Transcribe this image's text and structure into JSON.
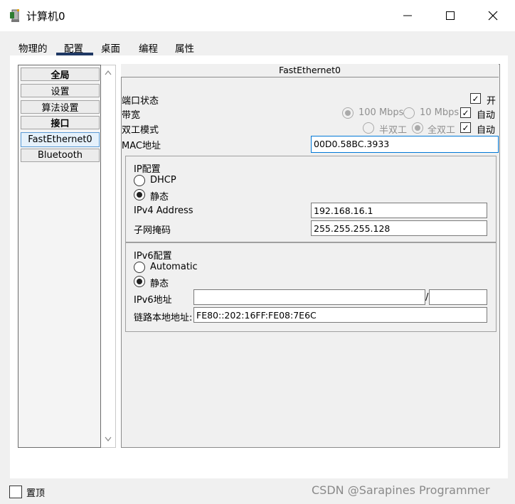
{
  "window": {
    "title": "计算机0",
    "app_icon": "computer-app-icon",
    "controls": [
      "minimize-icon",
      "maximize-icon",
      "close-icon"
    ]
  },
  "tabs": [
    {
      "label": "物理的"
    },
    {
      "label": "配置",
      "active": true
    },
    {
      "label": "桌面"
    },
    {
      "label": "编程"
    },
    {
      "label": "属性"
    }
  ],
  "sidebar": {
    "items": [
      {
        "label": "全局",
        "kind": "header"
      },
      {
        "label": "设置"
      },
      {
        "label": "算法设置"
      },
      {
        "label": "接口",
        "kind": "header"
      },
      {
        "label": "FastEthernet0",
        "selected": true
      },
      {
        "label": "Bluetooth"
      }
    ]
  },
  "interface": {
    "title": "FastEthernet0",
    "port_status": {
      "label": "端口状态",
      "checked": true,
      "option": "开"
    },
    "bandwidth": {
      "label": "带宽",
      "options": [
        "100 Mbps",
        "10 Mbps"
      ],
      "selected": "100 Mbps",
      "auto_label": "自动",
      "auto": true
    },
    "duplex": {
      "label": "双工模式",
      "options": [
        "半双工",
        "全双工"
      ],
      "selected": "全双工",
      "auto_label": "自动",
      "auto": true
    },
    "mac": {
      "label": "MAC地址",
      "value": "00D0.58BC.3933"
    }
  },
  "ipv4": {
    "group_label": "IP配置",
    "dhcp_label": "DHCP",
    "static_label": "静态",
    "mode": "static",
    "address_label": "IPv4 Address",
    "address": "192.168.16.1",
    "mask_label": "子网掩码",
    "mask": "255.255.255.128"
  },
  "ipv6": {
    "group_label": "IPv6配置",
    "auto_label": "Automatic",
    "static_label": "静态",
    "mode": "static",
    "address_label": "IPv6地址",
    "address": "",
    "separator": "/",
    "prefix": "",
    "link_local_label": "链路本地地址:",
    "link_local": "FE80::202:16FF:FE08:7E6C"
  },
  "footer": {
    "pin_label": "置顶",
    "pin_checked": false,
    "watermark": "CSDN @Sarapines Programmer"
  }
}
